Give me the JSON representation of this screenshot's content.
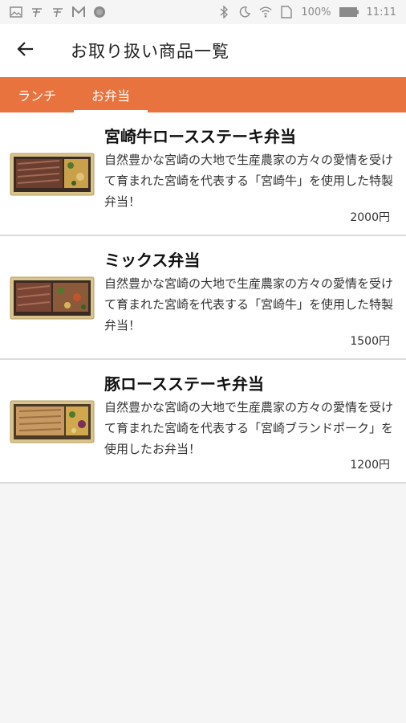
{
  "status_bar": {
    "battery": "100%",
    "time": "11:11"
  },
  "app_bar": {
    "title": "お取り扱い商品一覧",
    "back_icon": "arrow-back-icon"
  },
  "tabs": [
    {
      "label": "ランチ",
      "active": false
    },
    {
      "label": "お弁当",
      "active": true
    }
  ],
  "items": [
    {
      "name": "宮崎牛ロースステーキ弁当",
      "description": "自然豊かな宮崎の大地で生産農家の方々の愛情を受けて育まれた宮崎を代表する「宮崎牛」を使用した特製弁当！",
      "price": "2000円"
    },
    {
      "name": "ミックス弁当",
      "description": "自然豊かな宮崎の大地で生産農家の方々の愛情を受けて育まれた宮崎を代表する「宮崎牛」を使用した特製弁当！",
      "price": "1500円"
    },
    {
      "name": "豚ロースステーキ弁当",
      "description": "自然豊かな宮崎の大地で生産農家の方々の愛情を受けて育まれた宮崎を代表する「宮崎ブランドポーク」を使用したお弁当！",
      "price": "1200円"
    }
  ],
  "colors": {
    "accent": "#e8733e",
    "background": "#f5f5f5"
  }
}
